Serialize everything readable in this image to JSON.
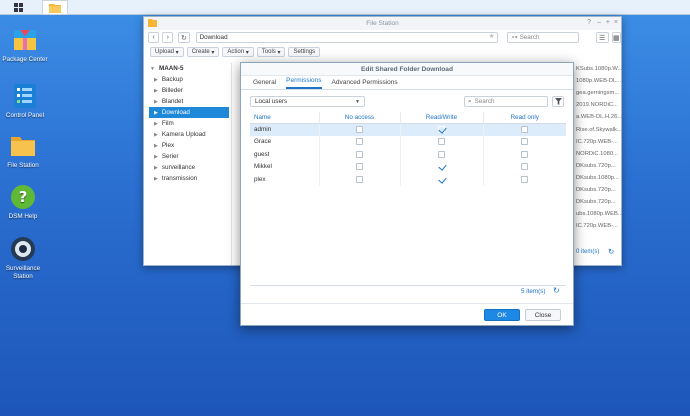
{
  "taskbar": {
    "icons": [
      "grid-icon",
      "file-station-icon"
    ]
  },
  "desktop": {
    "icons": [
      {
        "label": "Package Center"
      },
      {
        "label": "Control Panel"
      },
      {
        "label": "File Station"
      },
      {
        "label": "DSM Help"
      },
      {
        "label": "Surveillance Station"
      }
    ]
  },
  "filestation": {
    "title": "File Station",
    "path": "Download",
    "search_placeholder": "Search",
    "toolbar": {
      "upload": "Upload",
      "create": "Create",
      "action": "Action",
      "tools": "Tools",
      "settings": "Settings"
    },
    "root": "MAAN-5",
    "folders": [
      "Backup",
      "Billeder",
      "Blandet",
      "Download",
      "Film",
      "Kamera Upload",
      "Plex",
      "Serier",
      "surveillance",
      "transmission"
    ],
    "active_folder": "Download",
    "file_fragments": [
      "KSubs.1080p.W...",
      "1080p.WEB-DL...",
      "gea.gerningsm...",
      "2019.NORDiC...",
      "a.WEB-DL.H.26...",
      "Rise.of.Skywalk...",
      "IC.720p.WEB-...",
      "NORDiC.1080...",
      "DKsubs.720p...",
      "DKsubs.1080p...",
      "DKsubs.720p...",
      "DKsubs.720p...",
      "ubs.1080p.WEB...",
      "IC.720p.WEB-..."
    ],
    "footer_count": "0 item(s)"
  },
  "dialog": {
    "title": "Edit Shared Folder Download",
    "tabs": [
      "General",
      "Permissions",
      "Advanced Permissions"
    ],
    "active_tab": "Permissions",
    "user_filter": "Local users",
    "search_placeholder": "Search",
    "columns": [
      "Name",
      "No access",
      "Read/Write",
      "Read only"
    ],
    "rows": [
      {
        "name": "admin",
        "no_access": false,
        "read_write": true,
        "read_only": false
      },
      {
        "name": "Grace",
        "no_access": false,
        "read_write": false,
        "read_only": false
      },
      {
        "name": "guest",
        "no_access": false,
        "read_write": false,
        "read_only": false
      },
      {
        "name": "Mikkel",
        "no_access": false,
        "read_write": true,
        "read_only": false
      },
      {
        "name": "plex",
        "no_access": false,
        "read_write": true,
        "read_only": false
      }
    ],
    "count": "5 item(s)",
    "ok": "OK",
    "close": "Close"
  },
  "colors": {
    "accent": "#1e88e5",
    "desktop_top": "#3d8fe6",
    "desktop_bottom": "#1d56b8"
  }
}
